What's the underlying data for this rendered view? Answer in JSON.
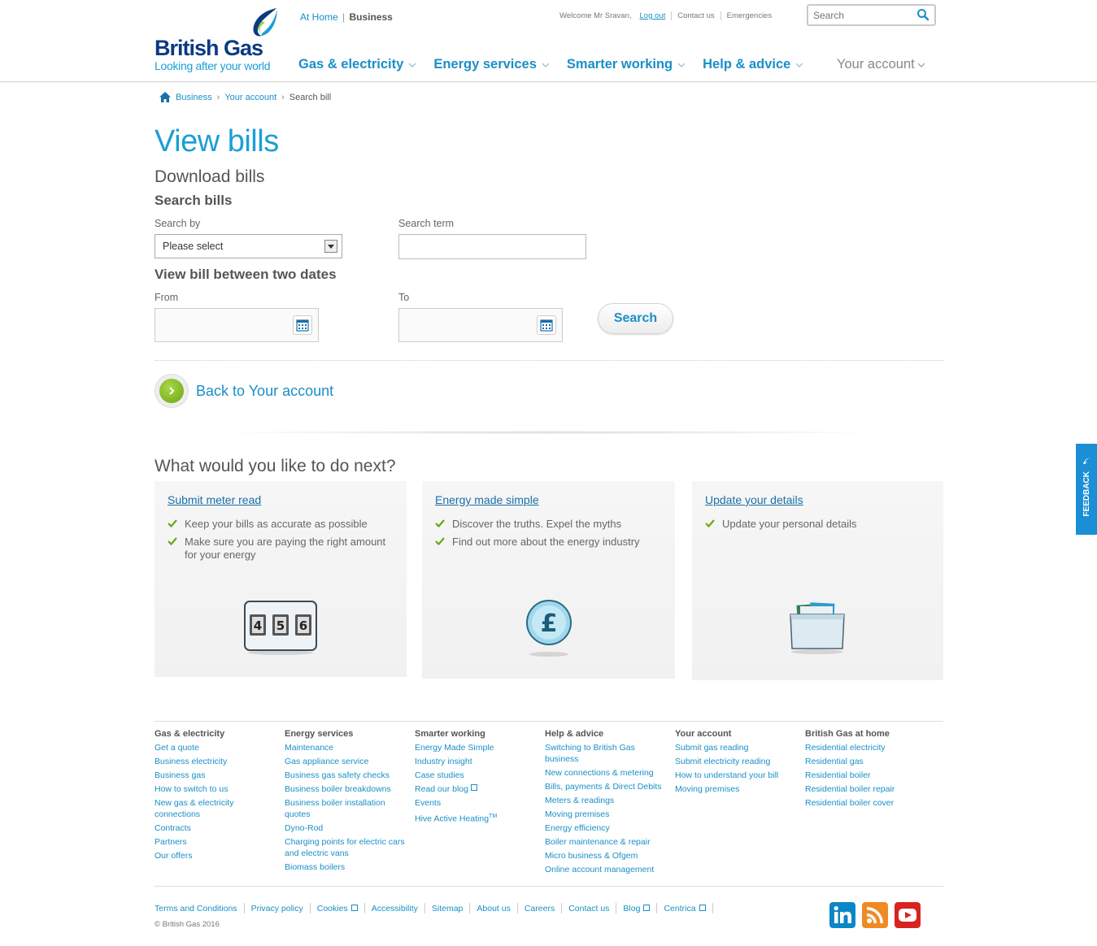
{
  "brand": {
    "name": "British Gas",
    "tagline": "Looking after your world"
  },
  "site_switch": {
    "home": "At Home",
    "separator": "|",
    "business": "Business"
  },
  "utility": {
    "welcome": "Welcome Mr Sravan,",
    "logout": "Log out",
    "contact": "Contact us",
    "emergencies": "Emergencies"
  },
  "search": {
    "placeholder": "Search"
  },
  "nav": {
    "items": [
      "Gas & electricity",
      "Energy services",
      "Smarter working",
      "Help & advice"
    ],
    "account": "Your account"
  },
  "breadcrumb": {
    "items": [
      "Business",
      "Your account"
    ],
    "current": "Search bill",
    "separator": "›"
  },
  "page": {
    "title": "View bills",
    "subtitle": "Download bills",
    "search_heading": "Search bills",
    "search_by_label": "Search by",
    "search_by_value": "Please select",
    "search_term_label": "Search term",
    "dates_heading": "View bill between two dates",
    "from_label": "From",
    "to_label": "To",
    "search_button": "Search",
    "back_link": "Back to Your account",
    "next_heading": "What would you like to do next?"
  },
  "cards": [
    {
      "title": "Submit meter read",
      "bullets": [
        "Keep your bills as accurate as possible",
        "Make sure you are paying the right amount for your energy"
      ],
      "digits": [
        "4",
        "5",
        "6"
      ]
    },
    {
      "title": "Energy made simple",
      "bullets": [
        "Discover the truths. Expel the myths",
        "Find out more about the energy industry"
      ],
      "symbol": "£"
    },
    {
      "title": "Update your details",
      "bullets": [
        "Update your personal details"
      ]
    }
  ],
  "feedback": "FEEDBACK",
  "footer": {
    "columns": [
      {
        "heading": "Gas & electricity",
        "links": [
          "Get a quote",
          "Business electricity",
          "Business gas",
          "How to switch to us",
          "New gas & electricity connections",
          "Contracts",
          "Partners",
          "Our offers"
        ]
      },
      {
        "heading": "Energy services",
        "links": [
          "Maintenance",
          "Gas appliance service",
          "Business gas safety checks",
          "Business boiler breakdowns",
          "Business boiler installation quotes",
          "Dyno-Rod",
          "Charging points for electric cars and electric vans",
          "Biomass boilers"
        ]
      },
      {
        "heading": "Smarter working",
        "links": [
          "Energy Made Simple",
          "Industry insight",
          "Case studies",
          "Read our blog",
          "Events",
          "Hive Active Heating"
        ],
        "hive_tm": "TM"
      },
      {
        "heading": "Help & advice",
        "links": [
          "Switching to British Gas business",
          "New connections & metering",
          "Bills, payments & Direct Debits",
          "Meters & readings",
          "Moving premises",
          "Energy efficiency",
          "Boiler maintenance & repair",
          "Micro business & Ofgem",
          "Online account management"
        ]
      },
      {
        "heading": "Your account",
        "links": [
          "Submit gas reading",
          "Submit electricity reading",
          "How to understand your bill",
          "Moving premises"
        ]
      },
      {
        "heading": "British Gas at home",
        "links": [
          "Residential electricity",
          "Residential gas",
          "Residential boiler",
          "Residential boiler repair",
          "Residential boiler cover"
        ]
      }
    ],
    "legal": [
      "Terms and Conditions",
      "Privacy policy",
      "Cookies",
      "Accessibility",
      "Sitemap",
      "About us",
      "Careers",
      "Contact us",
      "Blog",
      "Centrica"
    ],
    "copyright": "© British Gas 2016",
    "social": [
      "linkedin-icon",
      "rss-icon",
      "youtube-icon"
    ]
  },
  "colors": {
    "brand_blue": "#1a8fc7",
    "title_blue": "#1a9fd6",
    "navy": "#0a3a82",
    "green": "#6ba514",
    "feedback": "#1a8fd6"
  }
}
